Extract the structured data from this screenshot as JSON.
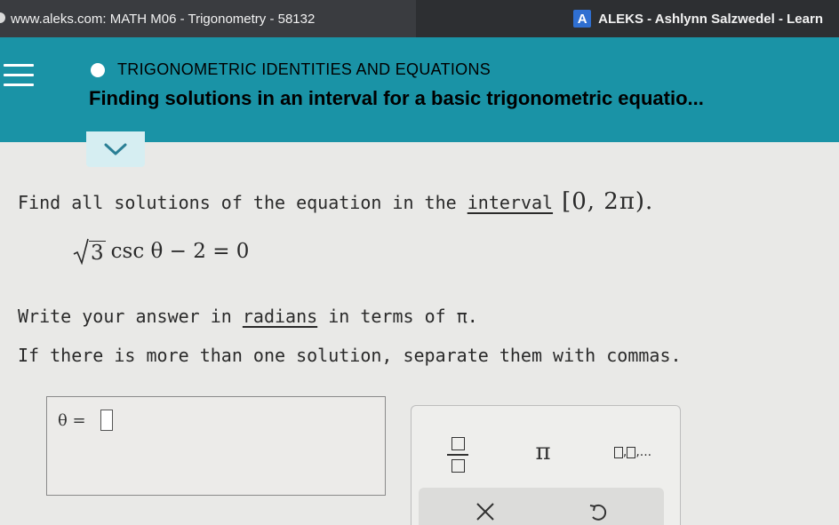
{
  "window": {
    "url_text": "www.aleks.com: MATH M06 - Trigonometry - 58132",
    "app_title": "ALEKS - Ashlynn Salzwedel - Learn",
    "logo_letter": "A"
  },
  "header": {
    "topic": "TRIGONOMETRIC IDENTITIES AND EQUATIONS",
    "lesson_title": "Finding solutions in an interval for a basic trigonometric equatio...",
    "background_color": "#1a93a6"
  },
  "problem": {
    "prompt_before": "Find all solutions of the equation in the ",
    "prompt_link": "interval",
    "interval": "[0, 2π).",
    "equation": {
      "radicand": "3",
      "rest": "csc θ − 2 = 0"
    },
    "instruction_line1_before": "Write your answer in ",
    "instruction_line1_link": "radians",
    "instruction_line1_after": " in terms of π.",
    "instruction_line2": "If there is more than one solution, separate them with commas."
  },
  "answer": {
    "variable_label": "θ ="
  },
  "toolbar": {
    "fraction_button": "fraction-icon",
    "pi_label": "π",
    "list_label_suffix": ",...",
    "clear_button": "close-icon",
    "undo_button": "undo-icon"
  }
}
